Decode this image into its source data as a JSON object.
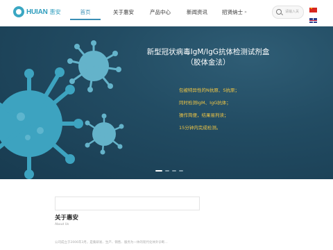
{
  "header": {
    "logo_text": "HUIAN",
    "logo_cn": "惠安",
    "nav": [
      {
        "label": "首页",
        "active": true
      },
      {
        "label": "关于惠安",
        "active": false
      },
      {
        "label": "产品中心",
        "active": false
      },
      {
        "label": "新闻资讯",
        "active": false
      },
      {
        "label": "招贤纳士",
        "active": false
      }
    ],
    "nav_more": "»",
    "search_placeholder": "请输入关"
  },
  "banner": {
    "title_line1": "新型冠状病毒IgM/IgG抗体检测试剂盒",
    "title_line2": "（胶体金法）",
    "features": [
      "包被特异性的N抗原、S抗原；",
      "同时检测IgM、IgG抗体；",
      "操作简便，结果易判读；",
      "15分钟内完成检测。"
    ],
    "slide_count": 4,
    "active_slide": 1
  },
  "about": {
    "title": "关于惠安",
    "subtitle": "About Us",
    "text": "公司成立于2006年3月，是集研发、生产、销售、服务为一体的现代化体外诊断…"
  },
  "colors": {
    "accent": "#3a8fb5",
    "banner_bg": "#224c63",
    "feature_text": "#f2c744"
  }
}
